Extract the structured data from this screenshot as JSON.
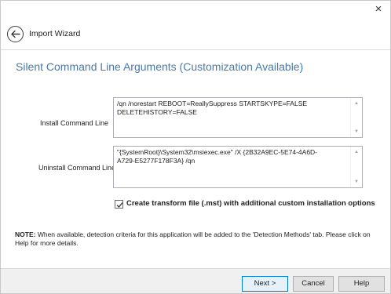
{
  "window": {
    "close_glyph": "×"
  },
  "header": {
    "back_icon": "back-arrow-icon",
    "title": "Import Wizard"
  },
  "page": {
    "section_title": "Silent Command Line Arguments (Customization Available)"
  },
  "install": {
    "label": "Install Command Line",
    "value": "/qn /norestart REBOOT=ReallySuppress STARTSKYPE=FALSE DELETEHISTORY=FALSE"
  },
  "uninstall": {
    "label": "Uninstall Command Line",
    "value": "\"{SystemRoot}\\System32\\msiexec.exe\" /X {2B32A9EC-5E74-4A6D-A729-E5277F178F3A} /qn"
  },
  "scroll": {
    "up_glyph": "▲",
    "down_glyph": "▼"
  },
  "transform_option": {
    "checked": true,
    "label": "Create transform file (.mst) with additional custom installation options"
  },
  "note": {
    "prefix": "NOTE:",
    "text": " When available, detection criteria for this application will be added to the 'Detection Methods' tab. Please click on Help for more details."
  },
  "buttons": {
    "next": "Next >",
    "cancel": "Cancel",
    "help": "Help"
  },
  "colors": {
    "section_title": "#4a7aaa",
    "footer_bg": "#f0f0f0",
    "default_button_border": "#0078d7"
  }
}
